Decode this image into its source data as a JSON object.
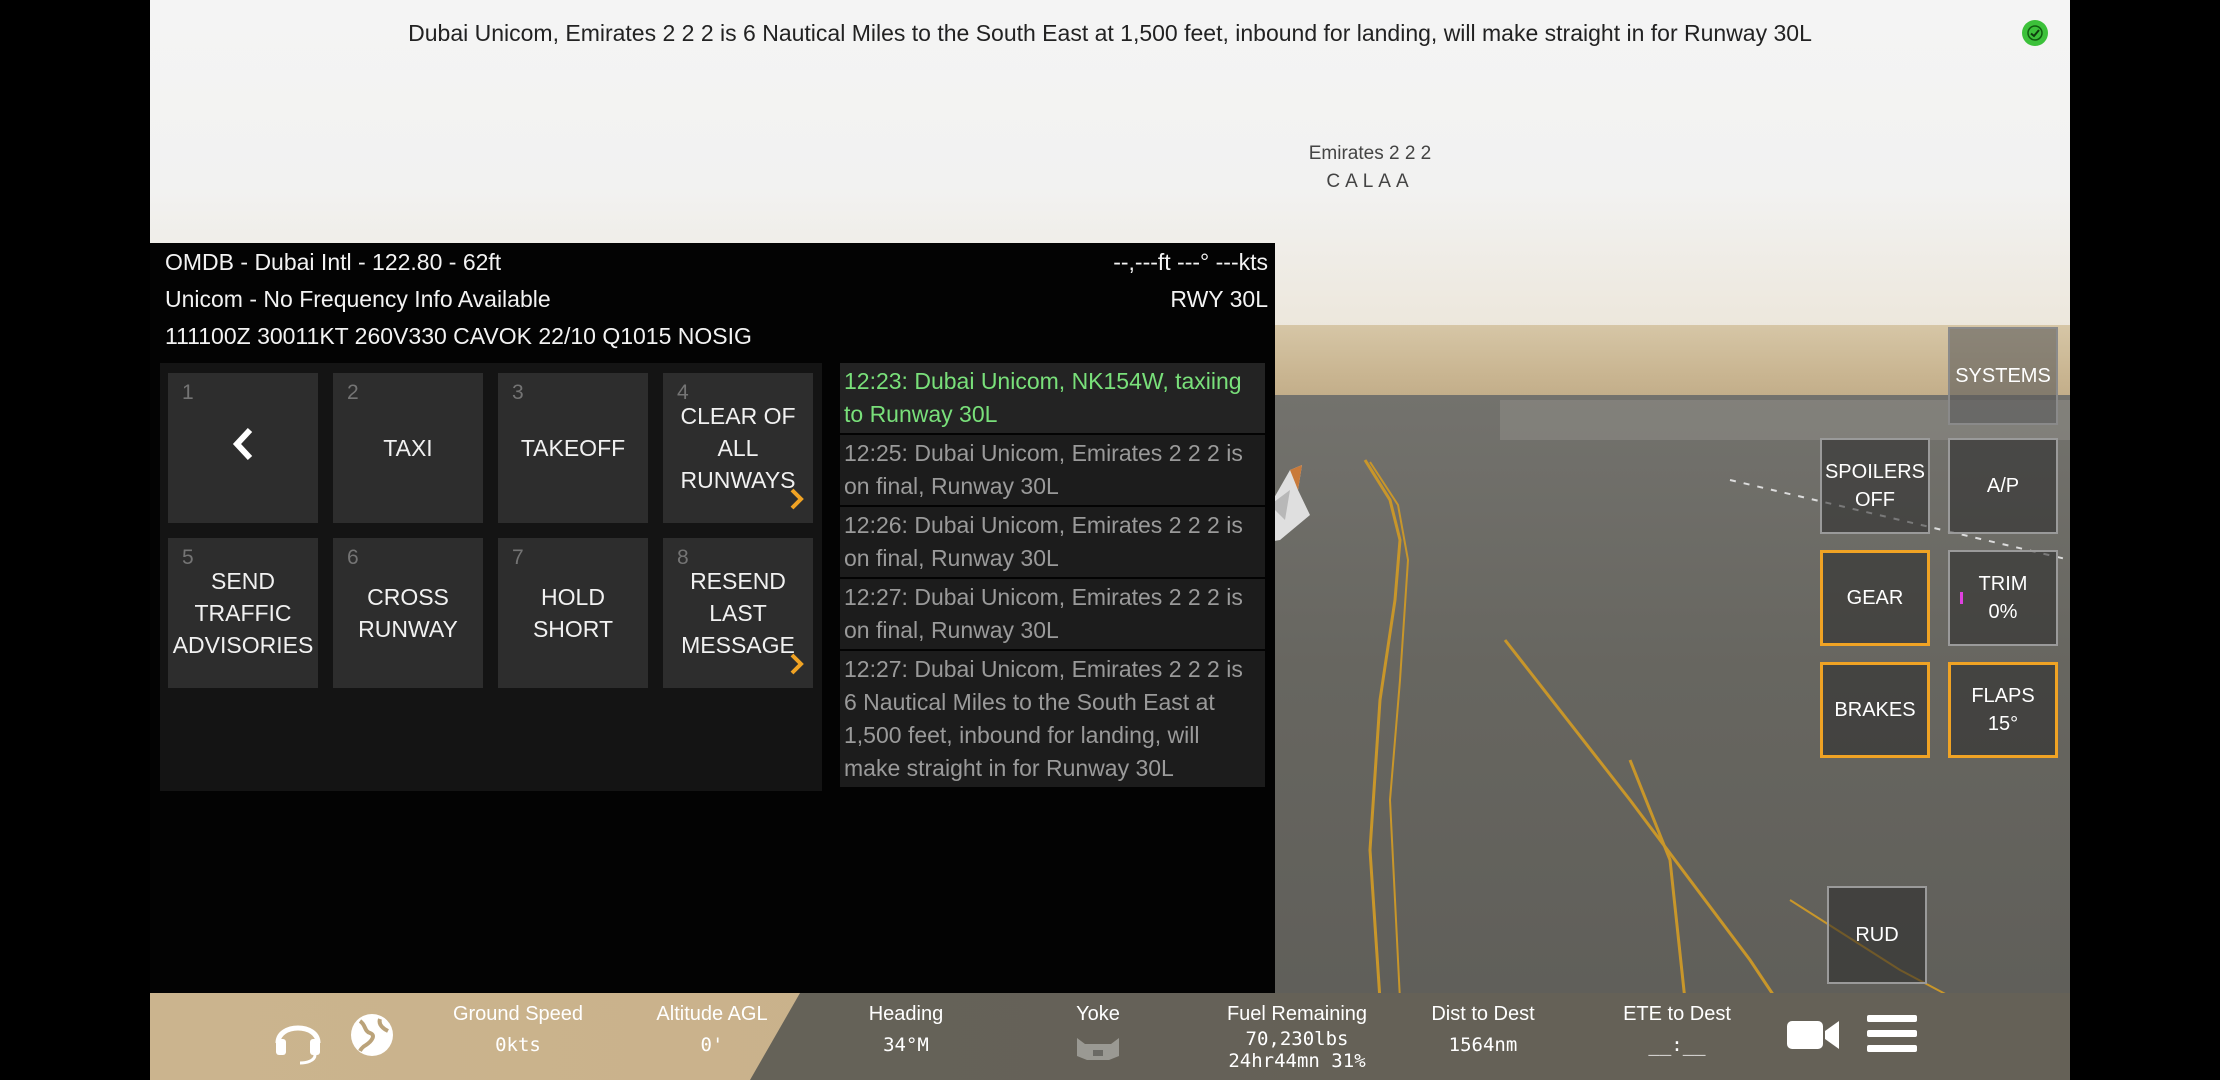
{
  "broadcast": "Dubai  Unicom, Emirates 2 2 2 is 6 Nautical Miles to the South East at 1,500 feet, inbound for landing, will make straight in for Runway 30L",
  "callsign_tag": {
    "name": "Emirates 2 2 2",
    "registration": "CALAA"
  },
  "atc_header": {
    "airport": "OMDB - Dubai Intl - 122.80 - 62ft",
    "frequency": "Unicom - No Frequency Info Available",
    "metar": "111100Z 30011KT 260V330 CAVOK 22/10 Q1015 NOSIG",
    "traffic_readout": "--,---ft  ---° ---kts",
    "runway": "RWY 30L"
  },
  "atc_options": [
    {
      "num": "1",
      "label": "",
      "icon": "chevron-left-icon"
    },
    {
      "num": "2",
      "label": "TAXI"
    },
    {
      "num": "3",
      "label": "TAKEOFF"
    },
    {
      "num": "4",
      "label": "CLEAR OF ALL RUNWAYS",
      "submenu": true
    },
    {
      "num": "5",
      "label": "SEND TRAFFIC ADVISORIES"
    },
    {
      "num": "6",
      "label": "CROSS RUNWAY"
    },
    {
      "num": "7",
      "label": "HOLD SHORT"
    },
    {
      "num": "8",
      "label": "RESEND LAST MESSAGE",
      "submenu": true
    }
  ],
  "messages": [
    {
      "text": "12:23: Dubai  Unicom, NK154W, taxiing to Runway 30L",
      "current": true
    },
    {
      "text": "12:25: Dubai  Unicom, Emirates 2 2 2 is on final, Runway 30L"
    },
    {
      "text": "12:26: Dubai  Unicom, Emirates 2 2 2 is on final, Runway 30L"
    },
    {
      "text": "12:27: Dubai  Unicom, Emirates 2 2 2 is on final, Runway 30L"
    },
    {
      "text": "12:27: Dubai  Unicom, Emirates 2 2 2 is 6 Nautical Miles to the South East at 1,500 feet, inbound for landing, will make straight in for Runway 30L"
    }
  ],
  "controls": {
    "systems": "SYSTEMS",
    "spoilers_line1": "SPOILERS",
    "spoilers_line2": "OFF",
    "autopilot": "A/P",
    "gear": "GEAR",
    "trim_line1": "TRIM",
    "trim_line2": "0%",
    "brakes": "BRAKES",
    "flaps_line1": "FLAPS",
    "flaps_line2": "15°",
    "rudder": "RUD"
  },
  "stats": {
    "ground_speed": {
      "label": "Ground Speed",
      "value": "0kts"
    },
    "altitude": {
      "label": "Altitude AGL",
      "value": "0'"
    },
    "heading": {
      "label": "Heading",
      "value": "34°M"
    },
    "yoke": {
      "label": "Yoke"
    },
    "fuel": {
      "label": "Fuel Remaining",
      "value1": "70,230lbs",
      "value2": "24hr44mn 31%"
    },
    "dist": {
      "label": "Dist to Dest",
      "value": "1564nm"
    },
    "ete": {
      "label": "ETE to Dest",
      "value": "__:__"
    }
  },
  "colors": {
    "accent_orange": "#f0a324",
    "current_msg_green": "#79e07a",
    "ok_green": "#3cc13a"
  }
}
